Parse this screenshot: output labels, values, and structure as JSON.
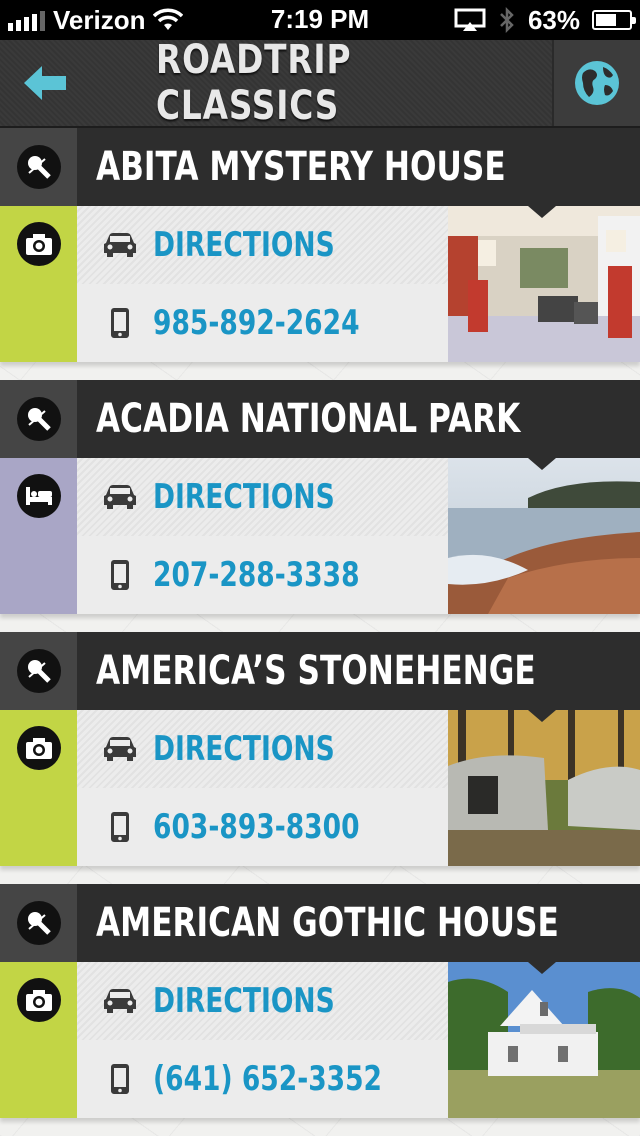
{
  "status_bar": {
    "carrier": "Verizon",
    "time": "7:19 PM",
    "battery": "63%",
    "battery_level": 0.63
  },
  "header": {
    "title": "ROADTRIP CLASSICS",
    "back_icon": "back-arrow-icon",
    "globe_icon": "globe-icon"
  },
  "colors": {
    "accent_blue": "#1a95c5",
    "green_category": "#c2d545",
    "lavender_category": "#a9a6c6",
    "header_dark": "#2d2d2d"
  },
  "places": [
    {
      "name": "ABITA MYSTERY HOUSE",
      "category_icon": "camera-icon",
      "category_color": "#c2d545",
      "directions_label": "DIRECTIONS",
      "phone": "985-892-2624",
      "photo": "gas-station-interior"
    },
    {
      "name": "ACADIA NATIONAL PARK",
      "category_icon": "bed-icon",
      "category_color": "#a9a6c6",
      "directions_label": "DIRECTIONS",
      "phone": "207-288-3338",
      "photo": "rocky-coast"
    },
    {
      "name": "AMERICA’S STONEHENGE",
      "category_icon": "camera-icon",
      "category_color": "#c2d545",
      "directions_label": "DIRECTIONS",
      "phone": "603-893-8300",
      "photo": "stone-structure-forest"
    },
    {
      "name": "AMERICAN GOTHIC HOUSE",
      "category_icon": "camera-icon",
      "category_color": "#c2d545",
      "directions_label": "DIRECTIONS",
      "phone": "(641) 652-3352",
      "photo": "white-farmhouse"
    }
  ]
}
